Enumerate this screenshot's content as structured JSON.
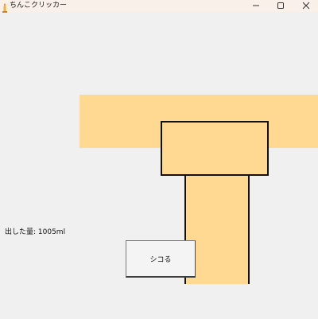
{
  "window": {
    "title": "ちんこクリッカー",
    "icon": "candle-icon",
    "controls": [
      "minimize-icon",
      "maximize-icon",
      "close-icon"
    ]
  },
  "main": {
    "amount_label": "出した量: 1005ml",
    "action_button_label": "シコる"
  },
  "colors": {
    "shape_fill": "#ffd992",
    "shape_outline": "#111111",
    "background": "#f0f0f0",
    "titlebar": "#faf0ea"
  }
}
